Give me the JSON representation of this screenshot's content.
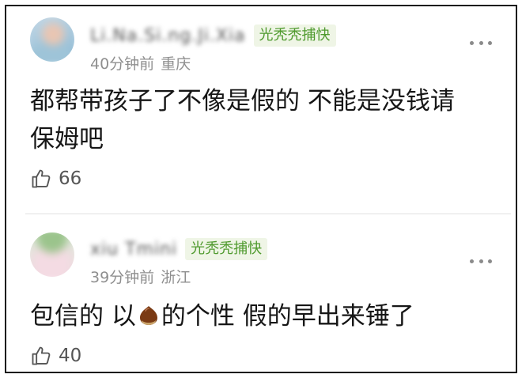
{
  "comments": [
    {
      "username": "Li.Na.Si.ng.Ji.Xia",
      "badge": "光秃秃捕快",
      "time": "40分钟前",
      "location": "重庆",
      "text_line1": "都帮带孩子了不像是假的 不能是没钱请",
      "text_line2": "保姆吧",
      "likes": "66"
    },
    {
      "username": "xiu Tmini",
      "badge": "光秃秃捕快",
      "time": "39分钟前",
      "location": "浙江",
      "text_before": "包信的 以",
      "emoji": "chestnut",
      "text_after": "的个性 假的早出来锤了",
      "likes": "40"
    }
  ],
  "colors": {
    "badge_text": "#4f9a2e",
    "badge_bg": "#eff5e6",
    "meta_text": "#8f8f8f",
    "body_text": "#161616"
  }
}
